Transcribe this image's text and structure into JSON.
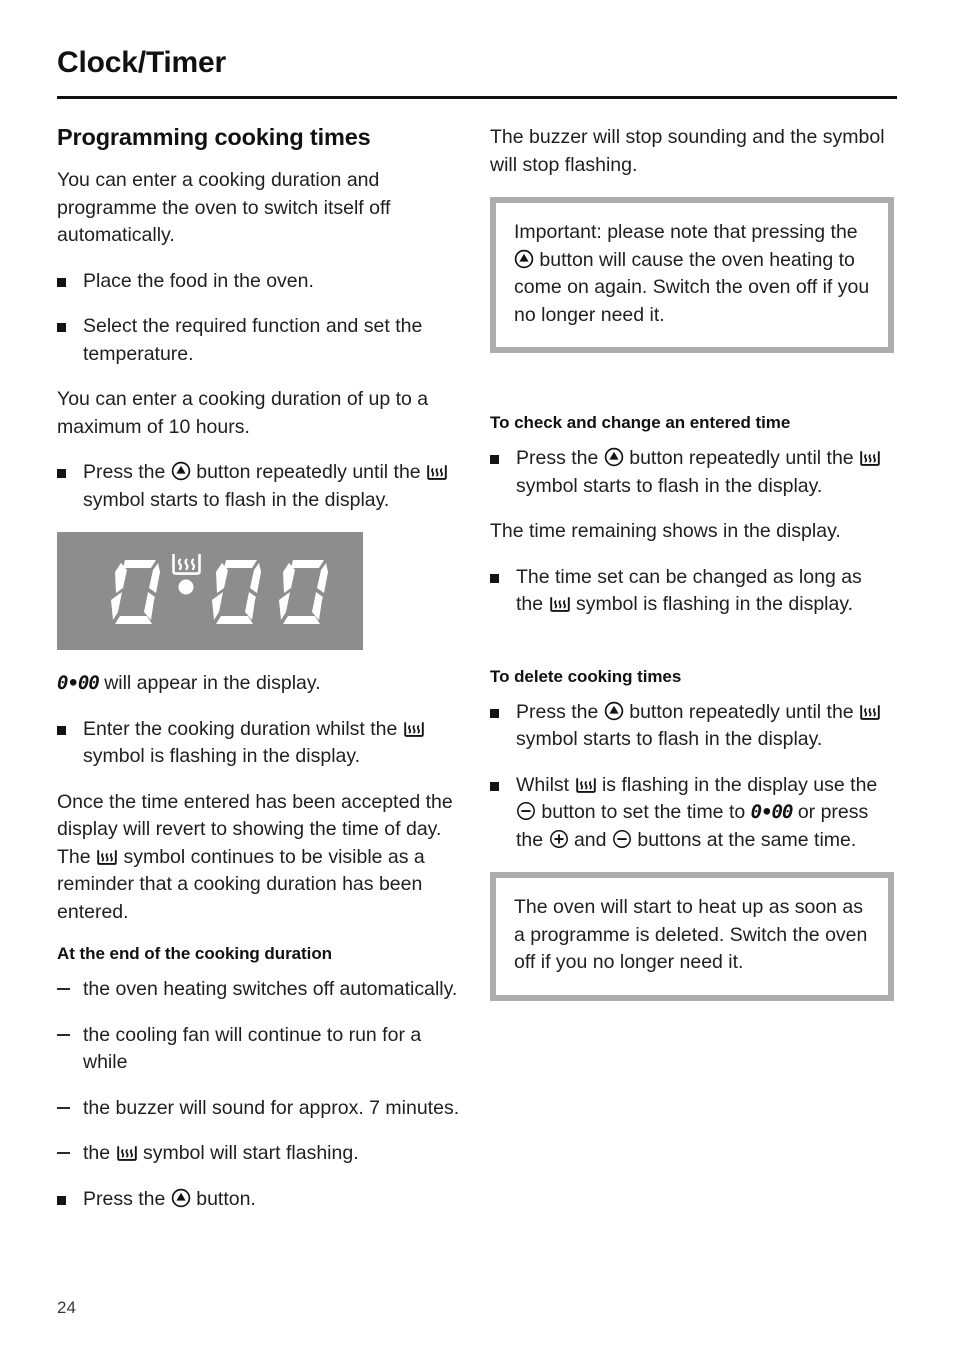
{
  "document": {
    "running_head": "Clock/Timer",
    "page_number": "24"
  },
  "icons": {
    "clock_button": "clock-button-icon",
    "heating_symbol": "heating-duration-symbol-icon",
    "plus_button": "plus-button-icon",
    "minus_button": "minus-button-icon"
  },
  "colors": {
    "lcd_background": "#8d8d8d",
    "lcd_segment": "#ffffff",
    "note_border": "#adadad",
    "text": "#1f1f1f",
    "rule": "#111111"
  },
  "left_column": {
    "heading": "Programming cooking times",
    "intro": "You can enter a cooking duration and programme the oven to switch itself off automatically.",
    "steps": [
      "Place the food in the oven.",
      "Select the required function and set the temperature."
    ],
    "max_duration_note": "You can enter a cooking duration of up to a maximum of 10 hours.",
    "press_button_step": {
      "before_button": "Press the",
      "after_button": "button repeatedly until the",
      "after_symbol": "symbol starts to flash in the display."
    },
    "display": {
      "value": "0:00",
      "digits_left": "0",
      "digits_right": "00",
      "separator": ":",
      "symbol": "heating-duration-symbol-icon"
    },
    "display_caption": {
      "value": "0•00",
      "text": "will appear in the display."
    },
    "enter_duration_step": {
      "before_symbol": "Enter the cooking duration whilst the",
      "after_symbol": "symbol is flashing in the display."
    },
    "accepted_para": {
      "before_symbol": "Once the time entered has been accepted the display will revert to showing the time of day. The",
      "after_symbol": "symbol continues to be visible as a reminder that a cooking duration has been entered."
    },
    "end_of_duration": {
      "heading": "At the end of the cooking duration",
      "items": [
        {
          "text": "the oven heating switches off automatically.",
          "has_symbol": false
        },
        {
          "text": "the cooling fan will continue to run for a while",
          "has_symbol": false
        },
        {
          "text": "the buzzer will sound for approx. 7 minutes.",
          "has_symbol": false
        },
        {
          "before_symbol": "the",
          "after_symbol": "symbol will start flashing.",
          "has_symbol": true
        }
      ],
      "final_step": {
        "before_button": "Press the",
        "after_button": "button."
      }
    }
  },
  "right_column": {
    "buzzer_para": "The buzzer will stop sounding and the symbol will stop flashing.",
    "important_note": {
      "before_button": "Important: please note that pressing the",
      "after_button": "button will cause the oven heating to come on again. Switch the oven off if you no longer need it."
    },
    "check_change": {
      "heading": "To check and change an entered time",
      "press_step": {
        "before_button": "Press the",
        "after_button": "button repeatedly until the",
        "after_symbol": "symbol starts to flash in the display."
      },
      "remaining_para": "The time remaining shows in the display.",
      "change_step": {
        "before_symbol": "The time set can be changed as long as the",
        "after_symbol": "symbol is flashing in the display."
      }
    },
    "delete_times": {
      "heading": "To delete cooking times",
      "press_step": {
        "before_button": "Press the",
        "after_button": "button repeatedly until the",
        "after_symbol": "symbol starts to flash in the display."
      },
      "whilst_step": {
        "s1": "Whilst",
        "s2": "is flashing in the display use the",
        "s3": "button to set the time to",
        "value": "0•00",
        "s4": "or press the",
        "s5": "and",
        "s6": "buttons at the same time."
      },
      "note": "The oven will start to heat up as soon as a programme is deleted. Switch the oven off if you no longer need it."
    }
  }
}
